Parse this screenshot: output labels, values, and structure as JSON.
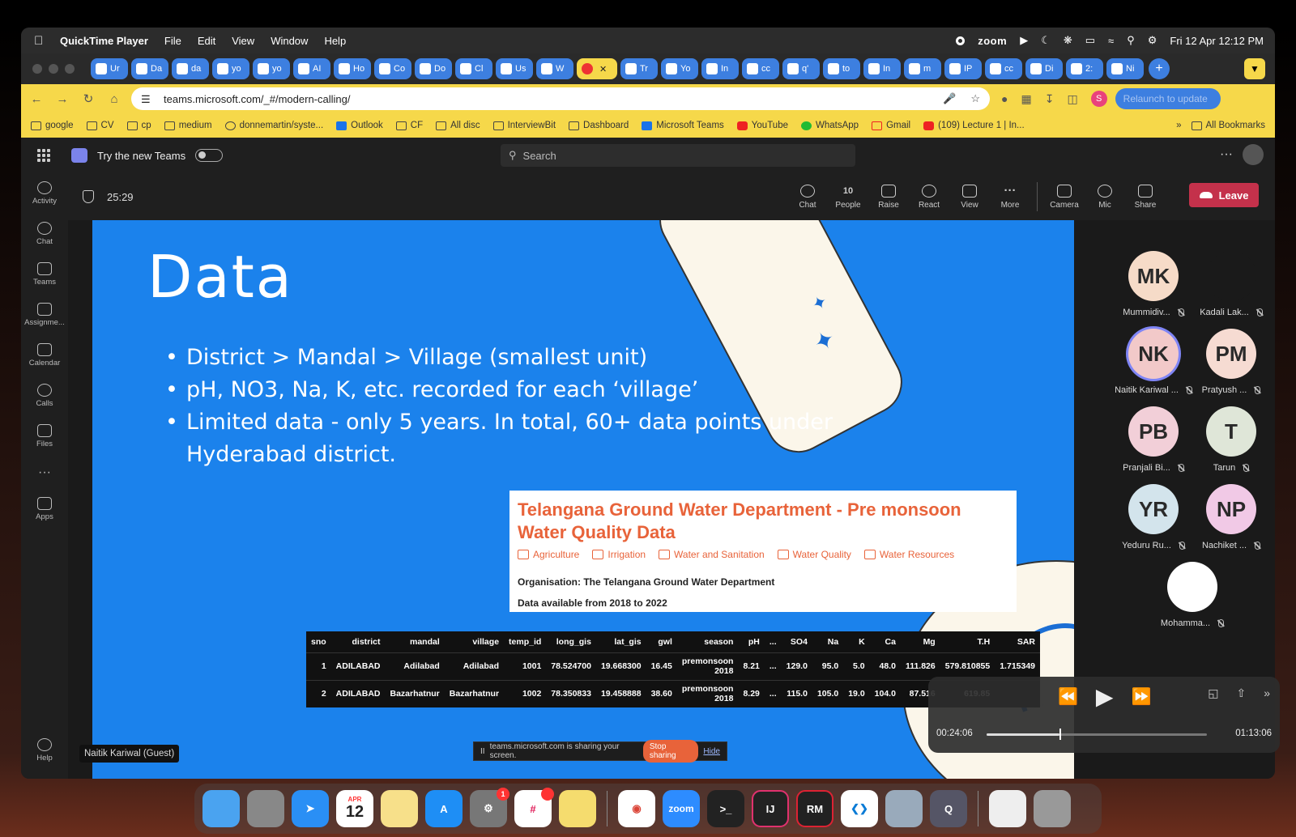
{
  "menubar": {
    "app_name": "QuickTime Player",
    "menus": [
      "File",
      "Edit",
      "View",
      "Window",
      "Help"
    ],
    "zoom_label": "zoom",
    "datetime": "Fri 12 Apr  12:12 PM"
  },
  "browser": {
    "tabs": [
      "Ur",
      "Da",
      "da",
      "yo",
      "yo",
      "AI",
      "Ho",
      "Co",
      "Do",
      "Cl",
      "Us",
      "W",
      "",
      "Tr",
      "Yo",
      "In",
      "cc",
      "q'",
      "to",
      "In",
      "m",
      "IP",
      "cc",
      "Di",
      "2:",
      "Ni"
    ],
    "active_tab_index": 12,
    "url": "teams.microsoft.com/_#/modern-calling/",
    "profile_initial": "S",
    "relaunch_label": "Relaunch to update",
    "bookmarks": [
      "google",
      "CV",
      "cp",
      "medium",
      "donnemartin/syste...",
      "Outlook",
      "CF",
      "All disc",
      "InterviewBit",
      "Dashboard",
      "Microsoft Teams",
      "YouTube",
      "WhatsApp",
      "Gmail",
      "(109) Lecture 1 | In..."
    ],
    "more_bookmarks": "»",
    "all_bookmarks": "All Bookmarks"
  },
  "teams": {
    "try_new_label": "Try the new Teams",
    "search_placeholder": "Search",
    "rail": [
      "Activity",
      "Chat",
      "Teams",
      "Assignme...",
      "Calendar",
      "Calls",
      "Files",
      "Apps"
    ],
    "help_label": "Help",
    "timer": "25:29",
    "tools": {
      "chat": "Chat",
      "people": "People",
      "people_count": "10",
      "raise": "Raise",
      "react": "React",
      "view": "View",
      "more": "More",
      "camera": "Camera",
      "mic": "Mic",
      "share": "Share"
    },
    "leave_label": "Leave",
    "presenter": "Naitik Kariwal (Guest)",
    "participants": [
      {
        "initials": "MK",
        "name": "Mummidiv...",
        "color": "#f6dbc8"
      },
      {
        "initials": "",
        "name": "Kadali Lak...",
        "color": "#1a1a1a"
      },
      {
        "initials": "NK",
        "name": "Naitik Kariwal ...",
        "color": "#f2c9c9"
      },
      {
        "initials": "PM",
        "name": "Pratyush ...",
        "color": "#f6dbd2"
      },
      {
        "initials": "PB",
        "name": "Pranjali Bi...",
        "color": "#f2cfd8"
      },
      {
        "initials": "T",
        "name": "Tarun",
        "color": "#dfe6d8"
      },
      {
        "initials": "YR",
        "name": "Yeduru Ru...",
        "color": "#d3e4ec"
      },
      {
        "initials": "NP",
        "name": "Nachiket ...",
        "color": "#f1c9e6"
      },
      {
        "initials": "",
        "name": "Mohamma...",
        "color": "#ffffff"
      }
    ]
  },
  "slide": {
    "title": "Data",
    "bullets": [
      "District > Mandal > Village (smallest unit)",
      "pH, NO3, Na, K, etc. recorded for each ‘village’",
      "Limited data - only 5 years. In total, 60+ data points under Hyderabad district."
    ],
    "dataset": {
      "title": "Telangana Ground Water Department - Pre monsoon Water Quality Data",
      "tags": [
        "Agriculture",
        "Irrigation",
        "Water and Sanitation",
        "Water Quality",
        "Water Resources"
      ],
      "organisation": "Organisation: The Telangana Ground Water Department",
      "availability": "Data available from 2018 to 2022"
    },
    "table": {
      "headers": [
        "sno",
        "district",
        "mandal",
        "village",
        "temp_id",
        "long_gis",
        "lat_gis",
        "gwl",
        "season",
        "pH",
        "...",
        "SO4",
        "Na",
        "K",
        "Ca",
        "Mg",
        "T.H",
        "SAR"
      ],
      "rows": [
        [
          "1",
          "ADILABAD",
          "Adilabad",
          "Adilabad",
          "1001",
          "78.524700",
          "19.668300",
          "16.45",
          "premonsoon 2018",
          "8.21",
          "...",
          "129.0",
          "95.0",
          "5.0",
          "48.0",
          "111.826",
          "579.810855",
          "1.715349"
        ],
        [
          "2",
          "ADILABAD",
          "Bazarhatnur",
          "Bazarhatnur",
          "1002",
          "78.350833",
          "19.458888",
          "38.60",
          "premonsoon 2018",
          "8.29",
          "...",
          "115.0",
          "105.0",
          "19.0",
          "104.0",
          "87.516",
          "619.85",
          ""
        ]
      ]
    },
    "share_banner": {
      "text": "teams.microsoft.com is sharing your screen.",
      "stop": "Stop sharing",
      "hide": "Hide"
    }
  },
  "quicktime": {
    "current_time": "00:24:06",
    "duration": "01:13:06",
    "progress": 0.33
  },
  "dock": {
    "calendar_month": "APR",
    "calendar_day": "12",
    "settings_badge": "1",
    "zoom_label": "zoom",
    "intellij_label": "IJ",
    "rm_label": "RM"
  }
}
